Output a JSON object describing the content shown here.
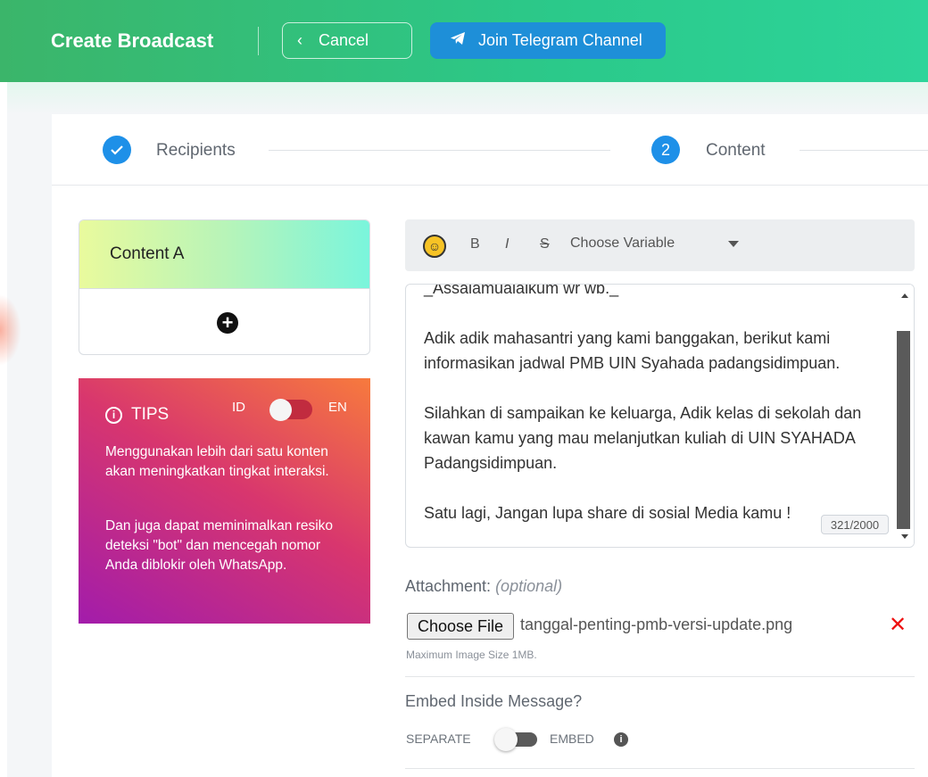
{
  "header": {
    "title": "Create Broadcast",
    "cancel_label": "Cancel",
    "telegram_label": "Join Telegram Channel"
  },
  "stepper": {
    "steps": [
      {
        "label": "Recipients",
        "state": "done"
      },
      {
        "label": "Content",
        "number": "2",
        "state": "active"
      }
    ]
  },
  "contents": {
    "tab_label": "Content A"
  },
  "tips": {
    "title": "TIPS",
    "lang_id": "ID",
    "lang_en": "EN",
    "p1": "Menggunakan lebih dari satu konten akan meningkatkan tingkat interaksi.",
    "p2": "Dan juga dapat meminimalkan resiko deteksi \"bot\" dan mencegah nomor Anda diblokir oleh WhatsApp."
  },
  "toolbar": {
    "bold": "B",
    "italic": "I",
    "strike": "S",
    "variable_placeholder": "Choose Variable"
  },
  "editor": {
    "text": "_Assalamualaikum wr wb._\n\nAdik adik mahasantri yang kami banggakan, berikut kami informasikan jadwal PMB UIN Syahada padangsidimpuan.\n\nSilahkan di sampaikan ke keluarga, Adik kelas di sekolah dan kawan kamu yang mau melanjutkan kuliah di UIN SYAHADA Padangsidimpuan.\n\nSatu lagi, Jangan lupa share di sosial Media kamu !",
    "counter": "321/2000"
  },
  "attachment": {
    "label": "Attachment:",
    "optional": "(optional)",
    "button_label": "Choose File",
    "file_name": "tanggal-penting-pmb-versi-update.png",
    "max_size": "Maximum Image Size 1MB."
  },
  "embed": {
    "question": "Embed Inside Message?",
    "left_label": "SEPARATE",
    "right_label": "EMBED"
  },
  "colors": {
    "header_start": "#3bb56a",
    "header_end": "#2dd49a",
    "step_active": "#1e90e8",
    "telegram_button": "#1e8fd8",
    "remove": "#ee1111"
  }
}
